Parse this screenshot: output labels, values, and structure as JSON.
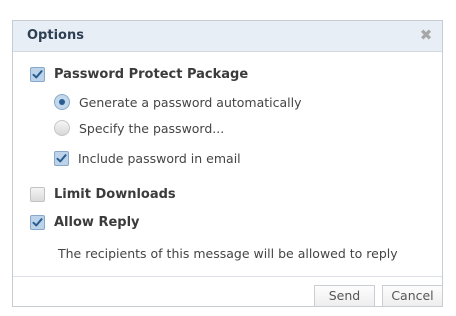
{
  "dialog": {
    "title": "Options",
    "close_glyph": "✖",
    "close_icon": "close-icon"
  },
  "options": {
    "password_protect": {
      "label": "Password Protect Package",
      "checked": true
    },
    "generate_auto": {
      "label": "Generate a password automatically",
      "selected": true
    },
    "specify_password": {
      "label": "Specify the password...",
      "selected": false
    },
    "include_in_email": {
      "label": "Include password in email",
      "checked": true
    },
    "limit_downloads": {
      "label": "Limit Downloads",
      "checked": false
    },
    "allow_reply": {
      "label": "Allow Reply",
      "checked": true
    },
    "reply_note": "The recipients of this message will be allowed to reply"
  },
  "footer": {
    "send_label": "Send",
    "cancel_label": "Cancel"
  },
  "colors": {
    "header_bg": "#e8eef6",
    "check_accent": "#2a5d8f",
    "border": "#c5ccd3"
  }
}
